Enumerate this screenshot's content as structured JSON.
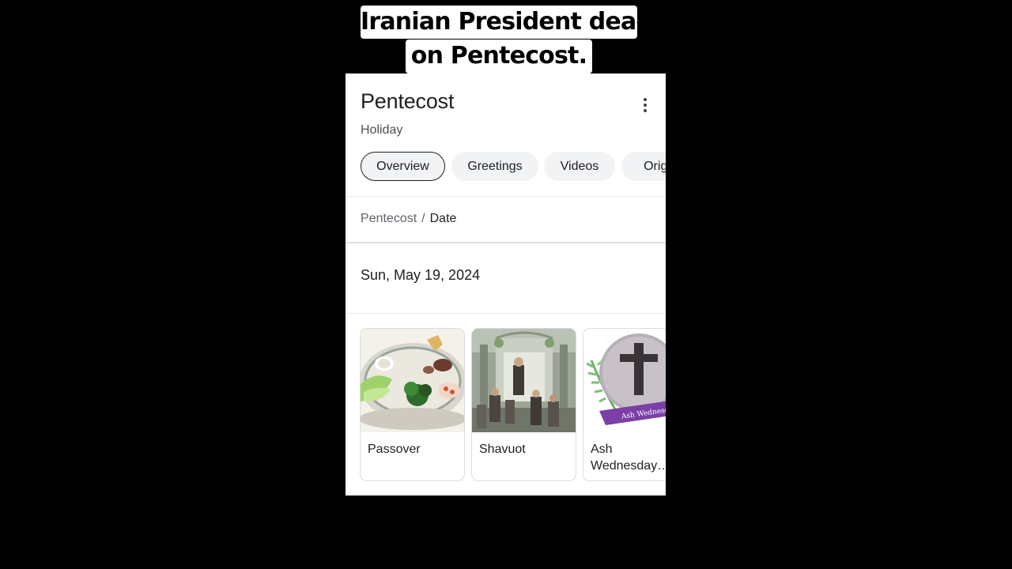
{
  "caption": {
    "line1": "Iranian President dead",
    "line2": "on Pentecost."
  },
  "panel": {
    "title": "Pentecost",
    "subtitle": "Holiday",
    "more_icon": "more-vert-icon",
    "chips": [
      {
        "label": "Overview",
        "active": true
      },
      {
        "label": "Greetings",
        "active": false
      },
      {
        "label": "Videos",
        "active": false
      },
      {
        "label": "Origi",
        "active": false
      }
    ],
    "breadcrumb": {
      "parent": "Pentecost",
      "separator": "/",
      "current": "Date"
    },
    "date": "Sun, May 19, 2024",
    "related": [
      {
        "label": "Passover",
        "image": "seder-plate-image"
      },
      {
        "label": "Shavuot",
        "image": "shavuot-painting-image"
      },
      {
        "label": "Ash Wednesday…",
        "image": "ash-wednesday-cross-image"
      }
    ]
  },
  "colors": {
    "background": "#000000",
    "card": "#ffffff",
    "chip": "#f1f3f4",
    "text": "#202124",
    "muted": "#5f6368"
  }
}
